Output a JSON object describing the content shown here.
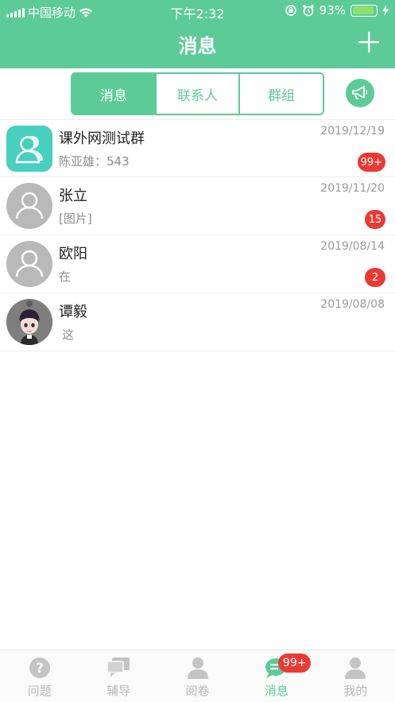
{
  "status_bar": {
    "carrier": "中国移动",
    "time": "下午2:32",
    "battery": "93%"
  },
  "header": {
    "title": "消息"
  },
  "segments": [
    {
      "label": "消息",
      "active": true
    },
    {
      "label": "联系人",
      "active": false
    },
    {
      "label": "群组",
      "active": false
    }
  ],
  "conversations": [
    {
      "name": "课外网测试群",
      "preview": "陈亚雄：543",
      "date": "2019/12/19",
      "badge": "99+",
      "avatar": "group"
    },
    {
      "name": "张立",
      "preview": "[图片]",
      "date": "2019/11/20",
      "badge": "15",
      "avatar": "person"
    },
    {
      "name": "欧阳",
      "preview": "在",
      "date": "2019/08/14",
      "badge": "2",
      "avatar": "person"
    },
    {
      "name": "谭毅",
      "preview": "这",
      "date": "2019/08/08",
      "badge": "",
      "avatar": "photo"
    }
  ],
  "tabbar": {
    "items": [
      {
        "label": "问题",
        "icon": "question-icon"
      },
      {
        "label": "辅导",
        "icon": "tutoring-icon"
      },
      {
        "label": "阅卷",
        "icon": "grading-icon"
      },
      {
        "label": "消息",
        "icon": "message-icon",
        "badge": "99+"
      },
      {
        "label": "我的",
        "icon": "profile-icon"
      }
    ]
  },
  "colors": {
    "accent": "#5dcb98",
    "badge": "#ea3a34"
  }
}
